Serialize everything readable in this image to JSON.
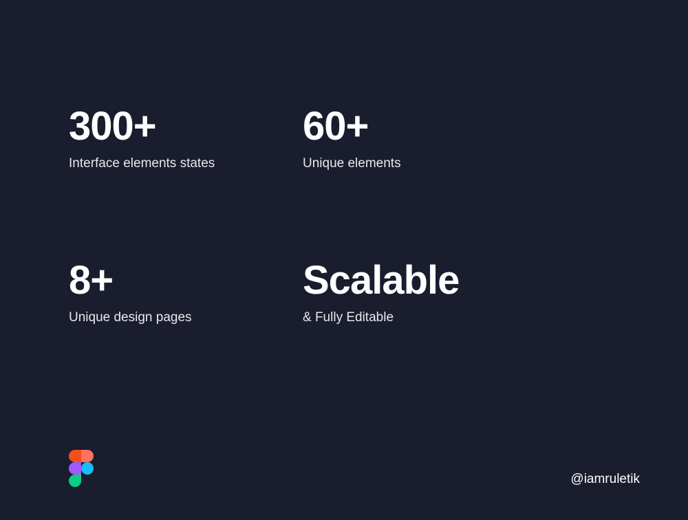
{
  "stats": [
    {
      "value": "300+",
      "label": "Interface elements states"
    },
    {
      "value": "60+",
      "label": "Unique elements"
    },
    {
      "value": "8+",
      "label": "Unique design pages"
    },
    {
      "value": "Scalable",
      "label": "& Fully Editable"
    }
  ],
  "footer": {
    "handle": "@iamruletik"
  },
  "colors": {
    "background": "#1a1d2e",
    "text": "#ffffff",
    "figma_red": "#F24E1E",
    "figma_orange": "#FF7262",
    "figma_purple": "#A259FF",
    "figma_blue": "#1ABCFE",
    "figma_green": "#0ACF83"
  }
}
